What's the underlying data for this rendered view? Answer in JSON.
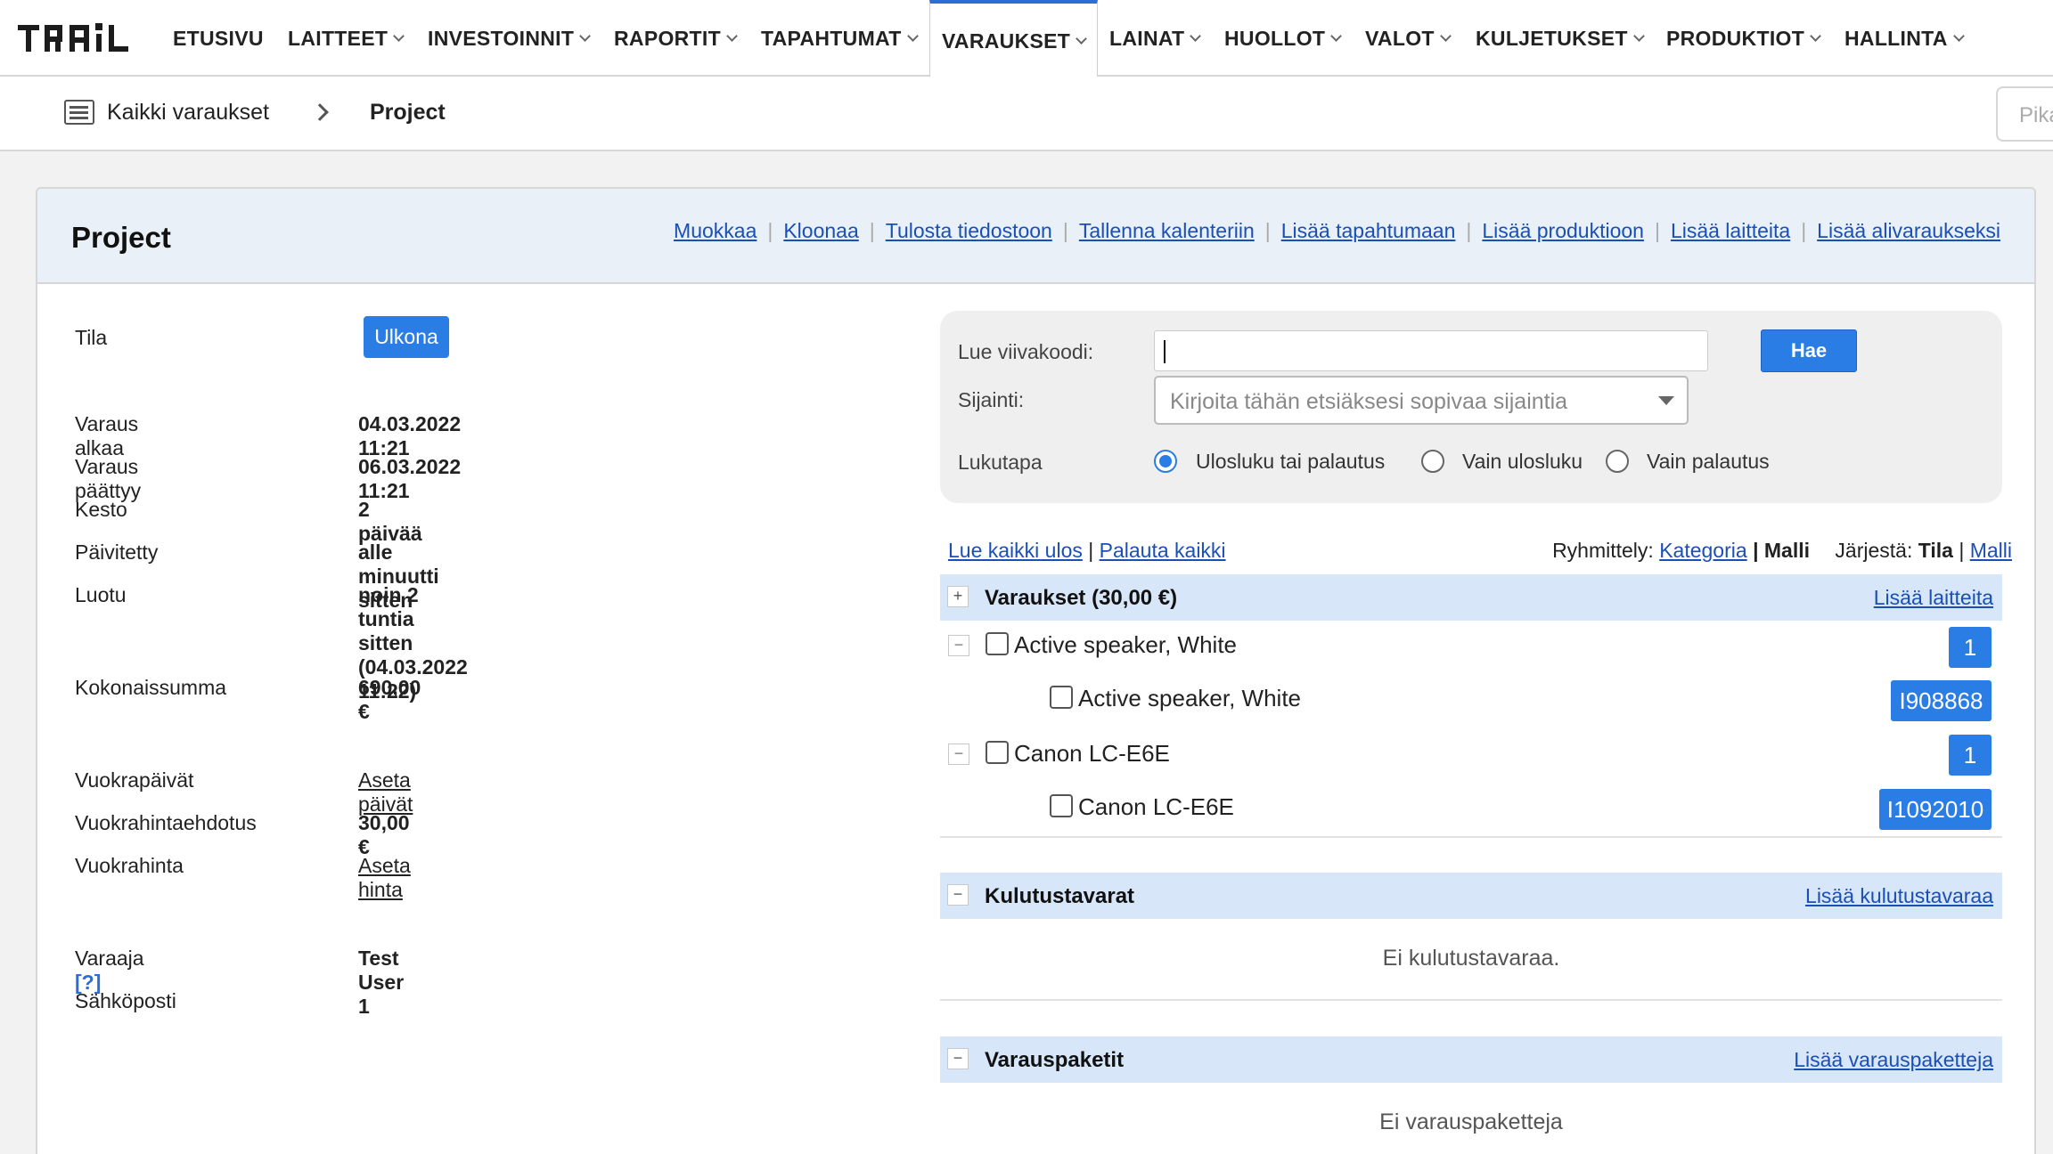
{
  "nav": {
    "logo_text": "TRAIL",
    "items": [
      {
        "label": "ETUSIVU",
        "dropdown": false
      },
      {
        "label": "LAITTEET",
        "dropdown": true
      },
      {
        "label": "INVESTOINNIT",
        "dropdown": true
      },
      {
        "label": "RAPORTIT",
        "dropdown": true
      },
      {
        "label": "TAPAHTUMAT",
        "dropdown": true
      },
      {
        "label": "VARAUKSET",
        "dropdown": true,
        "active": true
      },
      {
        "label": "LAINAT",
        "dropdown": true
      },
      {
        "label": "HUOLLOT",
        "dropdown": true
      },
      {
        "label": "VALOT",
        "dropdown": true
      },
      {
        "label": "KULJETUKSET",
        "dropdown": true
      },
      {
        "label": "PRODUKTIOT",
        "dropdown": true
      },
      {
        "label": "HALLINTA",
        "dropdown": true
      }
    ]
  },
  "breadcrumb": {
    "parent": "Kaikki varaukset",
    "current": "Project",
    "quicksearch_placeholder": "Pika"
  },
  "panel": {
    "title": "Project",
    "actions": [
      "Muokkaa",
      "Kloonaa",
      "Tulosta tiedostoon",
      "Tallenna kalenteriin",
      "Lisää tapahtumaan",
      "Lisää produktioon",
      "Lisää laitteita",
      "Lisää alivaraukseksi"
    ]
  },
  "info": {
    "status_label": "Tila",
    "status_value": "Ulkona",
    "start_label": "Varaus alkaa",
    "start_value": "04.03.2022 11:21",
    "end_label": "Varaus päättyy",
    "end_value": "06.03.2022 11:21",
    "duration_label": "Kesto",
    "duration_value": "2 päivää",
    "updated_label": "Päivitetty",
    "updated_value": "alle minuutti sitten",
    "created_label": "Luotu",
    "created_value": "noin 2 tuntia sitten (04.03.2022 11:22)",
    "total_label": "Kokonaissumma",
    "total_value": "690,00 €",
    "rental_days_label": "Vuokrapäivät",
    "rental_days_link": "Aseta päivät",
    "rental_suggest_label": "Vuokrahintaehdotus",
    "rental_suggest_value": "30,00 €",
    "rental_price_label": "Vuokrahinta",
    "rental_price_link": "Aseta hinta",
    "booker_label": "Varaaja",
    "booker_help": "[?]",
    "booker_value": "Test User 1",
    "email_label": "Sähköposti"
  },
  "scan": {
    "barcode_label": "Lue viivakoodi:",
    "search_button": "Hae",
    "location_label": "Sijainti:",
    "location_placeholder": "Kirjoita tähän etsiäksesi sopivaa sijaintia",
    "mode_label": "Lukutapa",
    "modes": [
      "Ulosluku tai palautus",
      "Vain ulosluku",
      "Vain palautus"
    ],
    "selected_mode": 0
  },
  "list": {
    "read_all_out": "Lue kaikki ulos",
    "separator": "|",
    "return_all": "Palauta kaikki",
    "grouping_label": "Ryhmittely:",
    "grouping_category": "Kategoria",
    "grouping_model": "Malli",
    "sort_label": "Järjestä:",
    "sort_status": "Tila",
    "sort_model": "Malli"
  },
  "sections": {
    "bookings": {
      "toggle": "+",
      "title": "Varaukset (30,00 €)",
      "link": "Lisää laitteita",
      "items": [
        {
          "name": "Active speaker, White",
          "count": "1",
          "child": "Active speaker, White",
          "child_code": "I908868"
        },
        {
          "name": "Canon LC-E6E",
          "count": "1",
          "child": "Canon LC-E6E",
          "child_code": "I1092010"
        }
      ]
    },
    "consumables": {
      "toggle": "−",
      "title": "Kulutustavarat",
      "link": "Lisää kulutustavaraa",
      "empty": "Ei kulutustavaraa."
    },
    "packages": {
      "toggle": "−",
      "title": "Varauspaketit",
      "link": "Lisää varauspaketteja",
      "empty": "Ei varauspaketteja"
    }
  },
  "colors": {
    "accent": "#2b7de6",
    "section_header": "#d7e6f8",
    "panel_header": "#eaf0f7",
    "link": "#1a4fb5"
  }
}
